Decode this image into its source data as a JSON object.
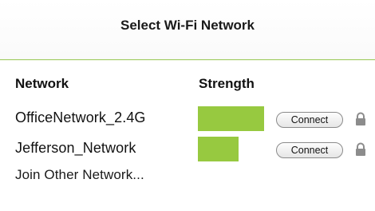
{
  "dialog": {
    "title": "Select Wi-Fi Network"
  },
  "columns": {
    "network": "Network",
    "strength": "Strength"
  },
  "networks": [
    {
      "name": "OfficeNetwork_2.4G",
      "signal_strength_fraction": 1.0,
      "connect_label": "Connect",
      "secured": true,
      "icon": "lock-icon"
    },
    {
      "name": "Jefferson_Network",
      "signal_strength_fraction": 0.62,
      "connect_label": "Connect",
      "secured": true,
      "icon": "lock-icon"
    }
  ],
  "join_other_label": "Join Other Network...",
  "colors": {
    "signal_bar": "#97c940",
    "divider": "#a8cf6e"
  }
}
